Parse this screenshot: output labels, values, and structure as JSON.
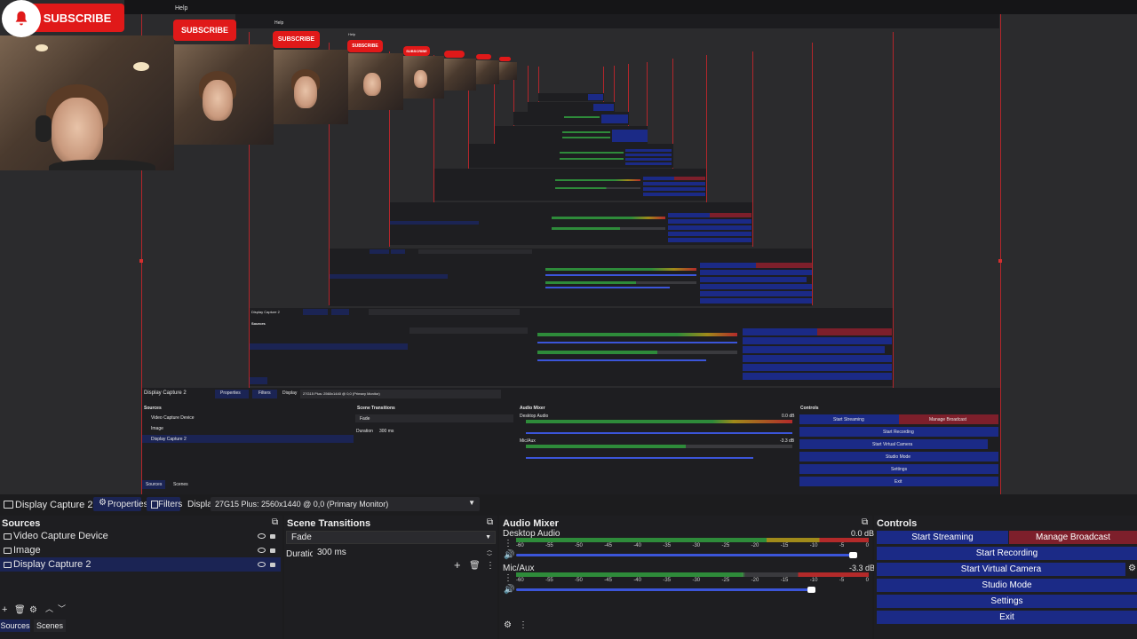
{
  "overlay": {
    "subscribe_label": "SUBSCRIBE",
    "help_label": "Help"
  },
  "toolbar": {
    "source_name": "Display Capture 2",
    "properties_label": "Properties",
    "filters_label": "Filters",
    "display_label": "Display",
    "display_value": "27G15 Plus: 2560x1440 @ 0,0 (Primary Monitor)"
  },
  "sources": {
    "title": "Sources",
    "items": [
      {
        "label": "Video Capture Device",
        "icon": "camera-icon"
      },
      {
        "label": "Image",
        "icon": "image-icon"
      },
      {
        "label": "Display Capture 2",
        "icon": "monitor-icon"
      }
    ],
    "tab_sources": "Sources",
    "tab_scenes": "Scenes"
  },
  "transitions": {
    "title": "Scene Transitions",
    "selected": "Fade",
    "duration_label": "Duration",
    "duration_value": "300 ms"
  },
  "mixer": {
    "title": "Audio Mixer",
    "channels": [
      {
        "name": "Desktop Audio",
        "db": "0.0 dB",
        "level": 0.97
      },
      {
        "name": "Mic/Aux",
        "db": "-3.3 dB",
        "level": 0.85
      }
    ],
    "scale": [
      "-60",
      "-55",
      "-50",
      "-45",
      "-40",
      "-35",
      "-30",
      "-25",
      "-20",
      "-15",
      "-10",
      "-5",
      "0"
    ]
  },
  "controls": {
    "title": "Controls",
    "start_streaming": "Start Streaming",
    "manage_broadcast": "Manage Broadcast",
    "start_recording": "Start Recording",
    "start_virtual_camera": "Start Virtual Camera",
    "studio_mode": "Studio Mode",
    "settings": "Settings",
    "exit": "Exit"
  },
  "nested": {
    "source_name": "Display Capture 2",
    "properties_label": "Properties",
    "filters_label": "Filters",
    "display_label": "Display",
    "display_value": "27G15 Plus: 2560x1440 @ 0,0 (Primary Monitor)",
    "sources_title": "Sources",
    "items": [
      "Video Capture Device",
      "Image",
      "Display Capture 2"
    ],
    "tab_sources": "Sources",
    "tab_scenes": "Scenes",
    "transitions_title": "Scene Transitions",
    "transition_value": "Fade",
    "duration_label": "Duration",
    "duration_value": "300 ms",
    "mixer_title": "Audio Mixer",
    "desktop_audio": "Desktop Audio",
    "desktop_db": "0.0 dB",
    "mic_aux": "Mic/Aux",
    "mic_db": "-3.3 dB",
    "controls_title": "Controls",
    "start_streaming": "Start Streaming",
    "manage_broadcast": "Manage Broadcast",
    "start_recording": "Start Recording",
    "start_virtual_camera": "Start Virtual Camera",
    "studio_mode": "Studio Mode",
    "settings": "Settings",
    "exit": "Exit"
  },
  "colors": {
    "accent_blue": "#1b2a86",
    "accent_red": "#7d1f2b",
    "border_red": "#b3262b",
    "meter_green": "#2e8b3a",
    "meter_yellow": "#a08a1a",
    "meter_red": "#b32a2a"
  }
}
